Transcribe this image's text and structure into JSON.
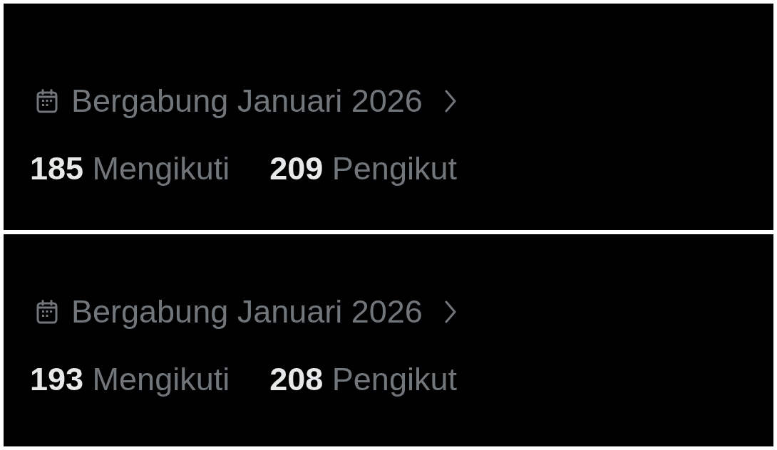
{
  "panels": [
    {
      "joined": "Bergabung Januari 2026",
      "stats": [
        {
          "count": "185",
          "label": "Mengikuti"
        },
        {
          "count": "209",
          "label": "Pengikut"
        }
      ]
    },
    {
      "joined": "Bergabung Januari 2026",
      "stats": [
        {
          "count": "193",
          "label": "Mengikuti"
        },
        {
          "count": "208",
          "label": "Pengikut"
        }
      ]
    }
  ]
}
